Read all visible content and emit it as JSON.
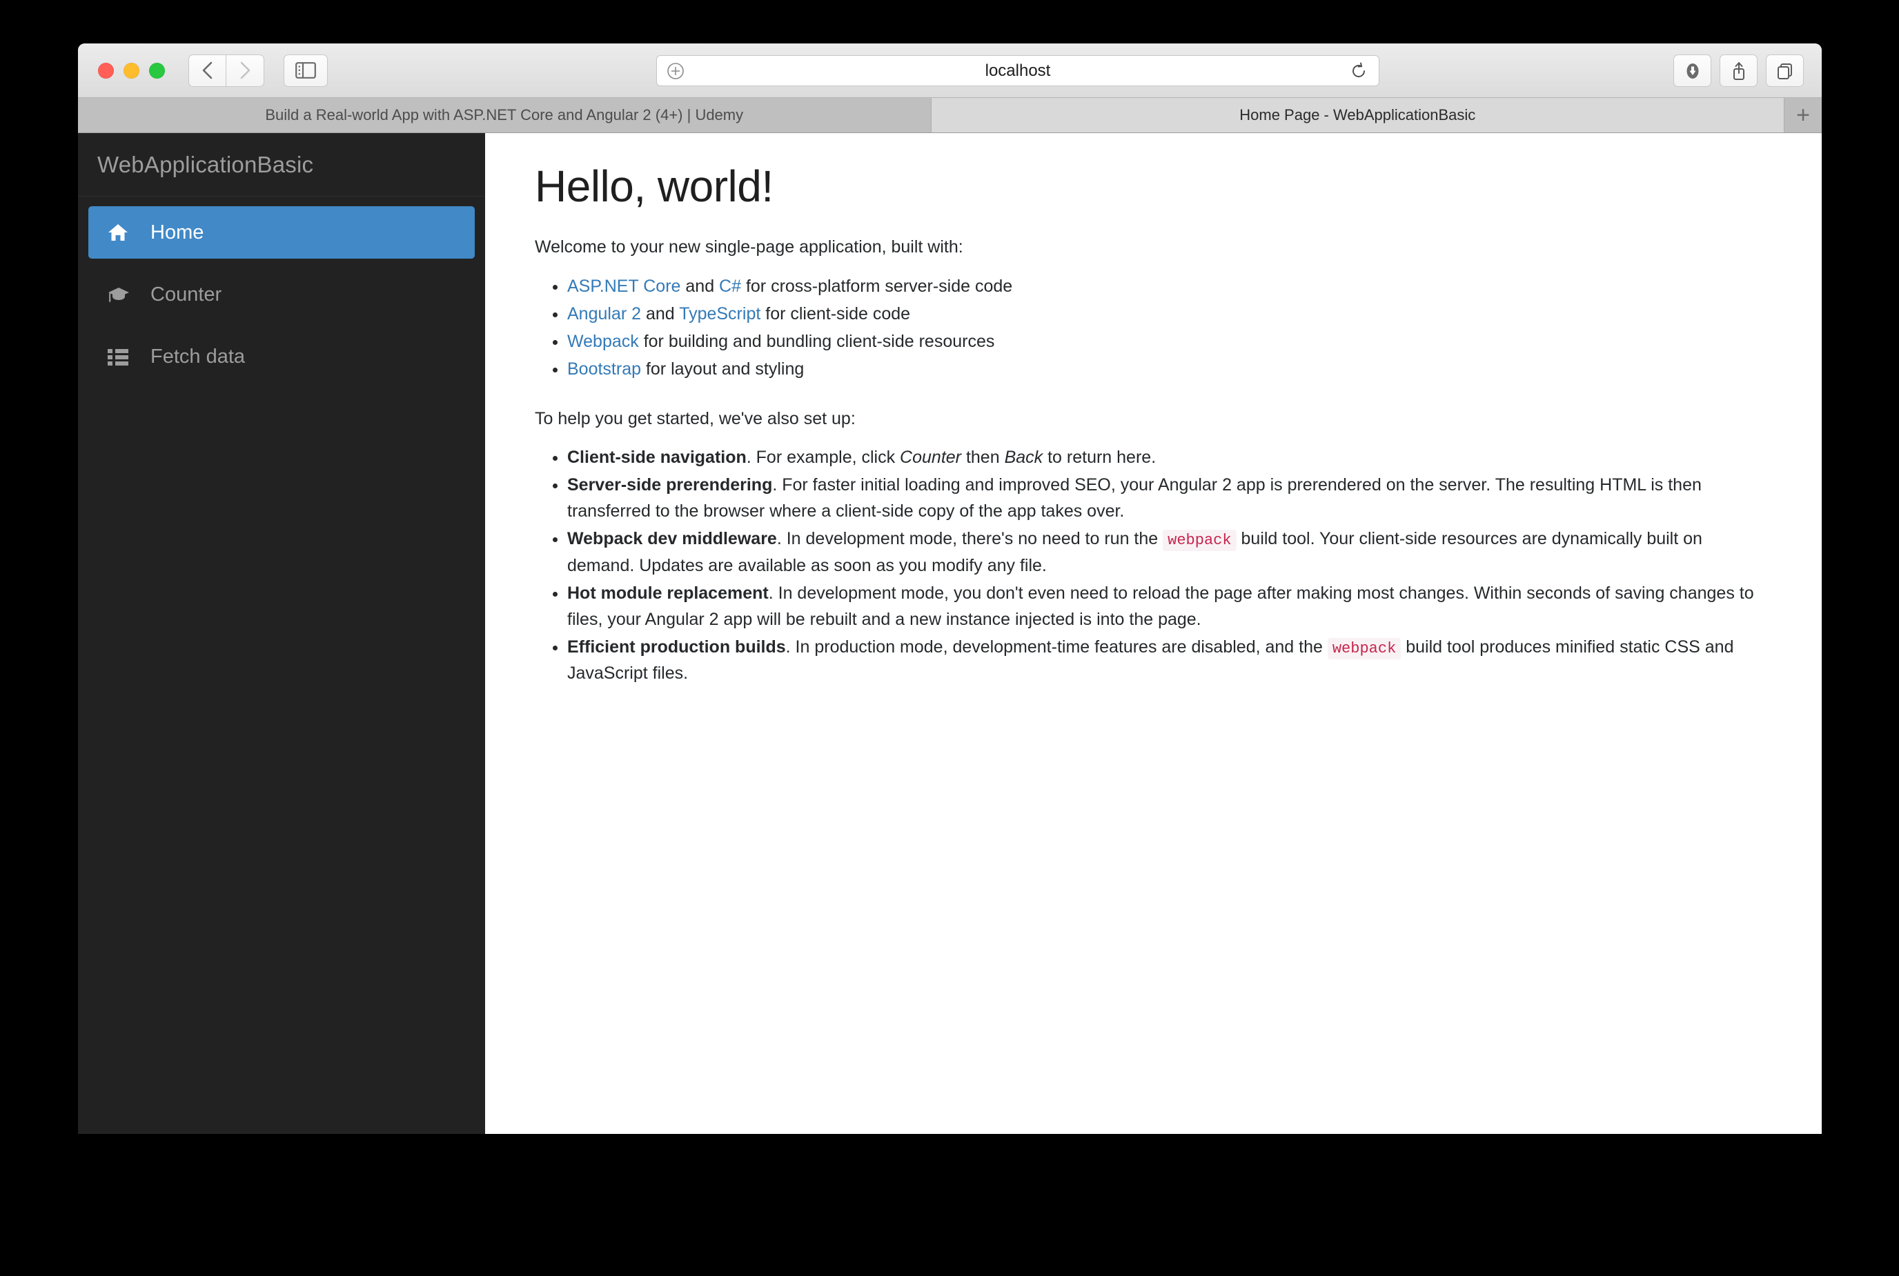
{
  "browser": {
    "window_controls": {
      "close": "close",
      "minimize": "minimize",
      "maximize": "maximize"
    },
    "nav": {
      "back_label": "Back",
      "forward_label": "Forward",
      "sidebar_toggle_label": "Show Sidebar"
    },
    "url_bar": {
      "value": "localhost",
      "add_bookmark_label": "Add bookmark",
      "reload_label": "Reload"
    },
    "right_tools": {
      "downloads_label": "Downloads",
      "share_label": "Share",
      "tab_overview_label": "Show Tab Overview"
    },
    "tabs": [
      {
        "title": "Build a Real-world App with ASP.NET Core and Angular 2 (4+) | Udemy",
        "active": false
      },
      {
        "title": "Home Page - WebApplicationBasic",
        "active": true
      }
    ],
    "new_tab_label": "+"
  },
  "sidebar": {
    "brand": "WebApplicationBasic",
    "items": [
      {
        "label": "Home",
        "icon": "home-icon",
        "active": true
      },
      {
        "label": "Counter",
        "icon": "graduation-cap-icon",
        "active": false
      },
      {
        "label": "Fetch data",
        "icon": "list-icon",
        "active": false
      }
    ]
  },
  "main": {
    "heading": "Hello, world!",
    "intro": "Welcome to your new single-page application, built with:",
    "built_with": [
      {
        "link1": "ASP.NET Core",
        "mid": " and ",
        "link2": "C#",
        "tail": " for cross-platform server-side code"
      },
      {
        "link1": "Angular 2",
        "mid": " and ",
        "link2": "TypeScript",
        "tail": " for client-side code"
      },
      {
        "link1": "Webpack",
        "mid": "",
        "link2": "",
        "tail": " for building and bundling client-side resources"
      },
      {
        "link1": "Bootstrap",
        "mid": "",
        "link2": "",
        "tail": " for layout and styling"
      }
    ],
    "setup_intro": "To help you get started, we've also set up:",
    "features": [
      {
        "title": "Client-side navigation",
        "body_1": ". For example, click ",
        "em_1": "Counter",
        "body_2": " then ",
        "em_2": "Back",
        "body_3": " to return here."
      },
      {
        "title": "Server-side prerendering",
        "body_1": ". For faster initial loading and improved SEO, your Angular 2 app is prerendered on the server. The resulting HTML is then transferred to the browser where a client-side copy of the app takes over."
      },
      {
        "title": "Webpack dev middleware",
        "body_1": ". In development mode, there's no need to run the ",
        "code": "webpack",
        "body_2": " build tool. Your client-side resources are dynamically built on demand. Updates are available as soon as you modify any file."
      },
      {
        "title": "Hot module replacement",
        "body_1": ". In development mode, you don't even need to reload the page after making most changes. Within seconds of saving changes to files, your Angular 2 app will be rebuilt and a new instance injected is into the page."
      },
      {
        "title": "Efficient production builds",
        "body_1": ". In production mode, development-time features are disabled, and the ",
        "code": "webpack",
        "body_2": " build tool produces minified static CSS and JavaScript files."
      }
    ]
  },
  "colors": {
    "sidebar_bg": "#222222",
    "sidebar_text": "#9d9d9d",
    "active_item_bg": "#4189c7",
    "link": "#337ab7",
    "code_text": "#c7254e",
    "code_bg": "#f9f2f4",
    "toolbar_bg": "#e6e6e6",
    "tab_active_bg": "#d9d9d9",
    "tab_inactive_bg": "#bfbfbf"
  }
}
